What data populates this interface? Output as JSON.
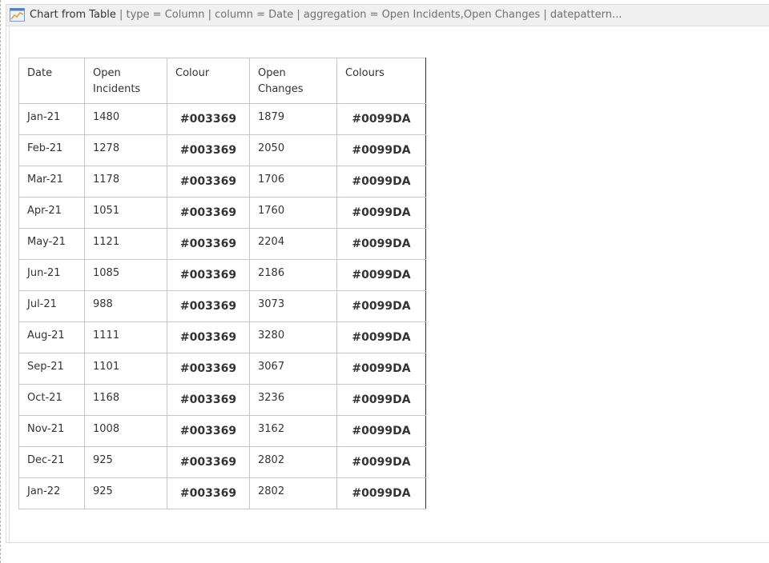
{
  "macro": {
    "name": "Chart from Table",
    "params": " | type = Column | column = Date | aggregation = Open Incidents,Open Changes | datepattern..."
  },
  "table": {
    "headers": [
      "Date",
      "Open Incidents",
      "Colour",
      "Open Changes",
      "Colours"
    ],
    "rows": [
      [
        "Jan-21",
        "1480",
        "#003369",
        "1879",
        "#0099DA"
      ],
      [
        "Feb-21",
        "1278",
        "#003369",
        "2050",
        "#0099DA"
      ],
      [
        "Mar-21",
        "1178",
        "#003369",
        "1706",
        "#0099DA"
      ],
      [
        "Apr-21",
        "1051",
        "#003369",
        "1760",
        "#0099DA"
      ],
      [
        "May-21",
        "1121",
        "#003369",
        "2204",
        "#0099DA"
      ],
      [
        "Jun-21",
        "1085",
        "#003369",
        "2186",
        "#0099DA"
      ],
      [
        "Jul-21",
        "988",
        "#003369",
        "3073",
        "#0099DA"
      ],
      [
        "Aug-21",
        "1111",
        "#003369",
        "3280",
        "#0099DA"
      ],
      [
        "Sep-21",
        "1101",
        "#003369",
        "3067",
        "#0099DA"
      ],
      [
        "Oct-21",
        "1168",
        "#003369",
        "3236",
        "#0099DA"
      ],
      [
        "Nov-21",
        "1008",
        "#003369",
        "3162",
        "#0099DA"
      ],
      [
        "Dec-21",
        "925",
        "#003369",
        "2802",
        "#0099DA"
      ],
      [
        "Jan-22",
        "925",
        "#003369",
        "2802",
        "#0099DA"
      ]
    ]
  }
}
